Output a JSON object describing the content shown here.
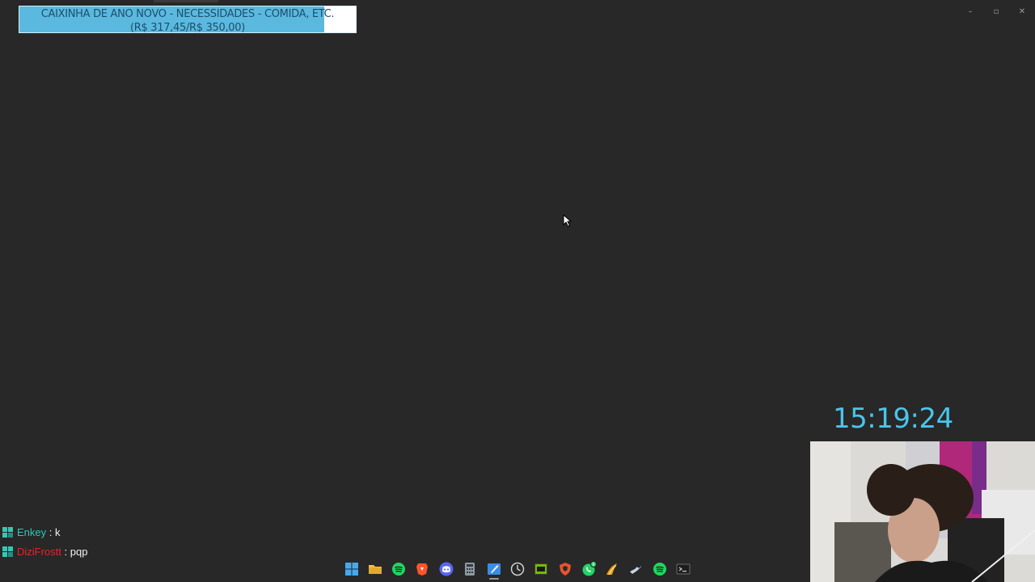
{
  "goal": {
    "title": "CAIXINHA DE ANO NOVO - NECESSIDADES - COMIDA, ETC.",
    "amount": "(R$ 317,45/R$ 350,00)",
    "progress": 0.907,
    "fill_color": "#5bb9e0"
  },
  "window_controls": {
    "minimize": "–",
    "maximize": "▫",
    "close": "✕"
  },
  "clock": {
    "time": "15:19:24",
    "color": "#48c6ea"
  },
  "chat": [
    {
      "user": "Enkey",
      "separator": " : ",
      "message": "k",
      "user_color": "#34c7b7",
      "badge": "mod-badge-icon"
    },
    {
      "user": "DiziFrostt",
      "separator": " : ",
      "message": "pqp",
      "user_color": "#e0262f",
      "badge": "mod-badge-icon"
    }
  ],
  "taskbar": {
    "icons": [
      "windows-start-icon",
      "file-explorer-icon",
      "spotify-icon",
      "brave-browser-icon",
      "discord-icon",
      "calculator-icon",
      "paint-icon",
      "clock-app-icon",
      "nvidia-icon",
      "shield-app-icon",
      "whatsapp-icon",
      "winamp-icon",
      "steam-icon",
      "spotify-icon",
      "terminal-icon"
    ],
    "whatsapp_badge": "6",
    "active_icon": "paint-icon"
  }
}
